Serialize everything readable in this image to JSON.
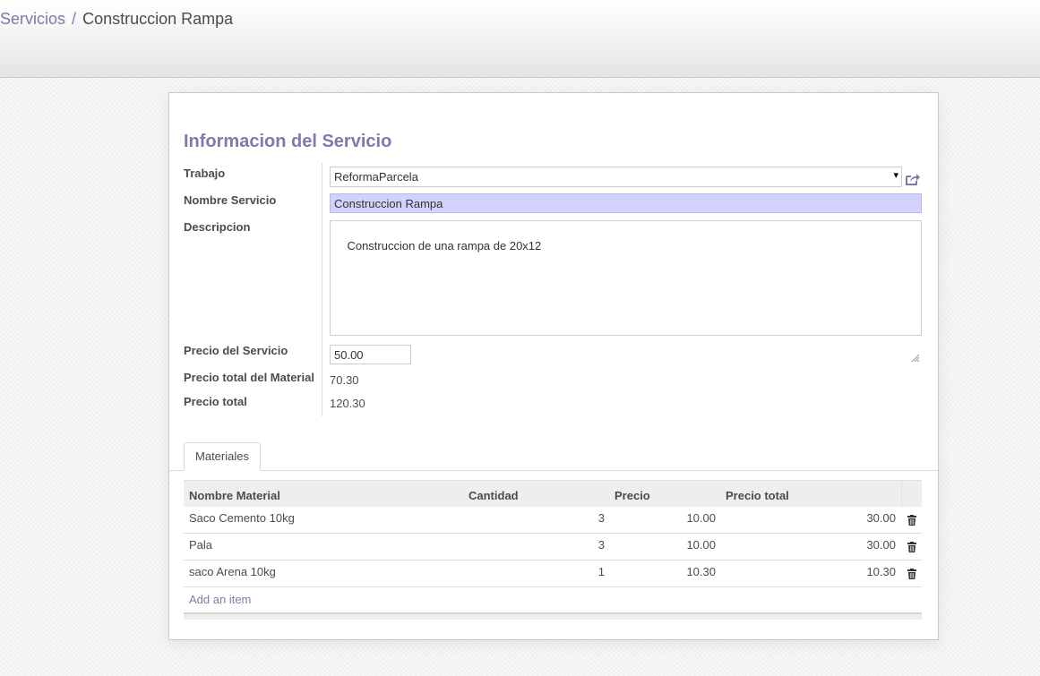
{
  "breadcrumb": {
    "parent": "Servicios",
    "separator": "/",
    "current": "Construccion Rampa"
  },
  "form": {
    "section_title": "Informacion del Servicio",
    "fields": {
      "trabajo": {
        "label": "Trabajo",
        "value": "ReformaParcela"
      },
      "nombre": {
        "label": "Nombre Servicio",
        "value": "Construccion Rampa"
      },
      "descripcion": {
        "label": "Descripcion",
        "value": "Construccion de una rampa de 20x12"
      },
      "precio_servicio": {
        "label": "Precio del Servicio",
        "value": "50.00"
      },
      "precio_material": {
        "label": "Precio total del Material",
        "value": "70.30"
      },
      "precio_total": {
        "label": "Precio total",
        "value": "120.30"
      }
    }
  },
  "tabs": [
    {
      "label": "Materiales",
      "active": true
    }
  ],
  "materials": {
    "columns": [
      "Nombre Material",
      "Cantidad",
      "Precio",
      "Precio total"
    ],
    "rows": [
      {
        "name": "Saco Cemento 10kg",
        "qty": "3",
        "price": "10.00",
        "total": "30.00"
      },
      {
        "name": "Pala",
        "qty": "3",
        "price": "10.00",
        "total": "30.00"
      },
      {
        "name": "saco Arena 10kg",
        "qty": "1",
        "price": "10.30",
        "total": "10.30"
      }
    ],
    "add_label": "Add an item"
  },
  "icons": {
    "external_link": "external-link-icon",
    "delete": "trash-icon",
    "dropdown": "chevron-down-icon",
    "resize": "resize-grip-icon"
  },
  "colors": {
    "accent": "#7c7bad",
    "required_field": "#d2d2ff"
  }
}
